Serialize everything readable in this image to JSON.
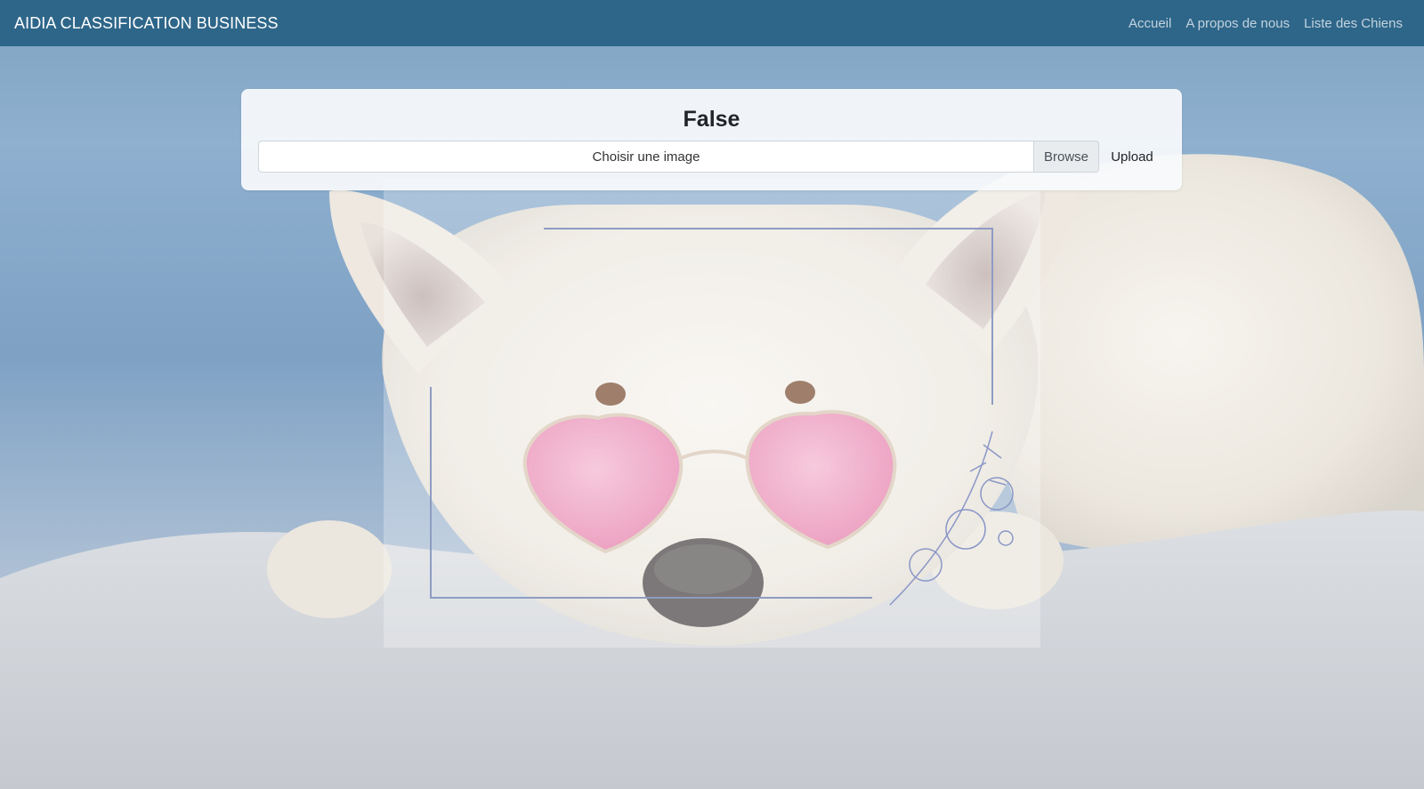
{
  "navbar": {
    "brand": "AIDIA CLASSIFICATION BUSINESS",
    "links": [
      "Accueil",
      "A propos de nous",
      "Liste des Chiens"
    ]
  },
  "card": {
    "title": "False",
    "file_input_label": "Choisir une image",
    "browse_label": "Browse",
    "upload_label": "Upload"
  },
  "colors": {
    "navbar": "#2e6689",
    "sky": "#8fb0cf",
    "dog": "#f1ede6",
    "glasses": "#ec9fc0"
  },
  "background": {
    "subject": "white dog wearing pink heart sunglasses lying on a blanket"
  }
}
